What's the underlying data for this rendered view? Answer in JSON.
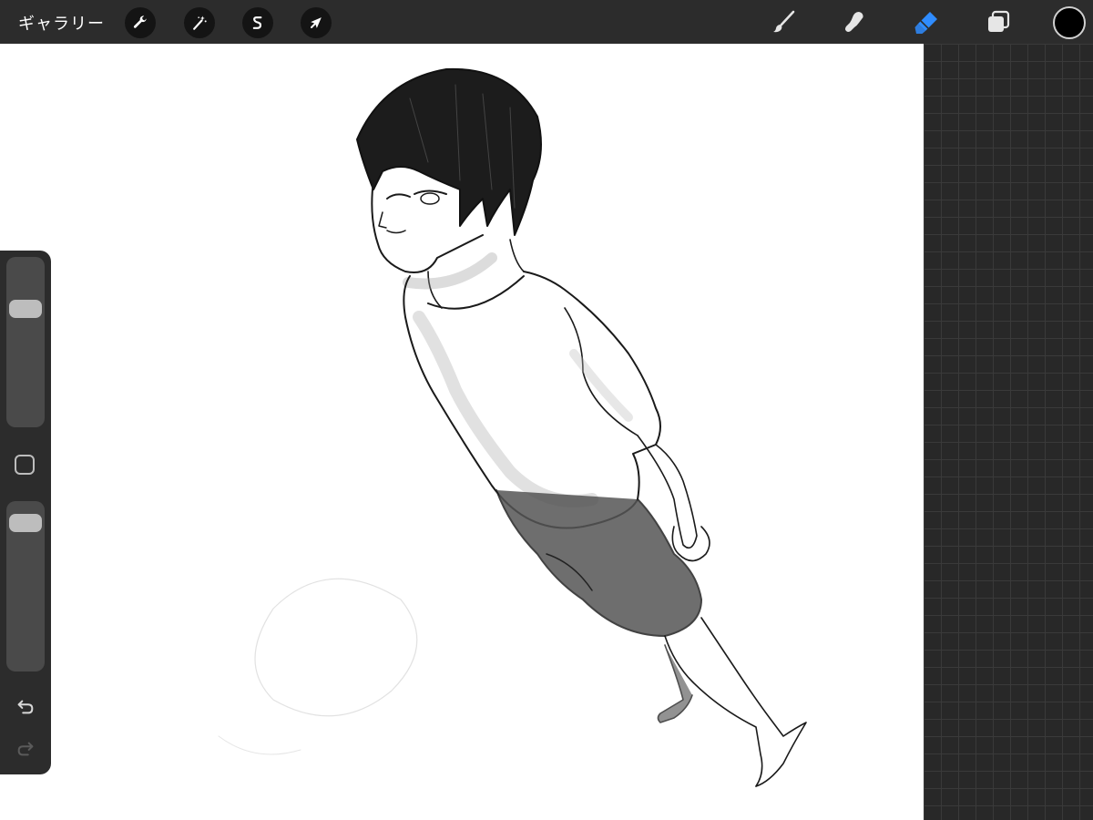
{
  "toolbar": {
    "gallery_label": "ギャラリー",
    "left_tools": [
      {
        "name": "actions",
        "icon": "wrench-icon"
      },
      {
        "name": "adjustments",
        "icon": "magic-wand-icon"
      },
      {
        "name": "selection",
        "icon": "selection-s-icon"
      },
      {
        "name": "transform",
        "icon": "arrow-cursor-icon"
      }
    ],
    "right_tools": [
      {
        "name": "paint",
        "icon": "brush-icon",
        "active": false
      },
      {
        "name": "smudge",
        "icon": "smudge-finger-icon",
        "active": false
      },
      {
        "name": "eraser",
        "icon": "eraser-icon",
        "active": true
      },
      {
        "name": "layers",
        "icon": "layers-icon",
        "active": false
      }
    ],
    "current_color": "#000000",
    "active_tool_color": "#2f8cff"
  },
  "sidebar": {
    "brush_size": 0.27,
    "brush_opacity": 0.06,
    "modify_icon": "square-outline-icon",
    "undo_icon": "undo-arrow-icon",
    "redo_icon": "redo-arrow-icon",
    "redo_enabled": false
  },
  "canvas": {
    "background": "#ffffff",
    "artwork": "pencil-sketch-figure"
  },
  "reference_grid": {
    "background": "#282828",
    "line_color": "#3a3a3a"
  }
}
